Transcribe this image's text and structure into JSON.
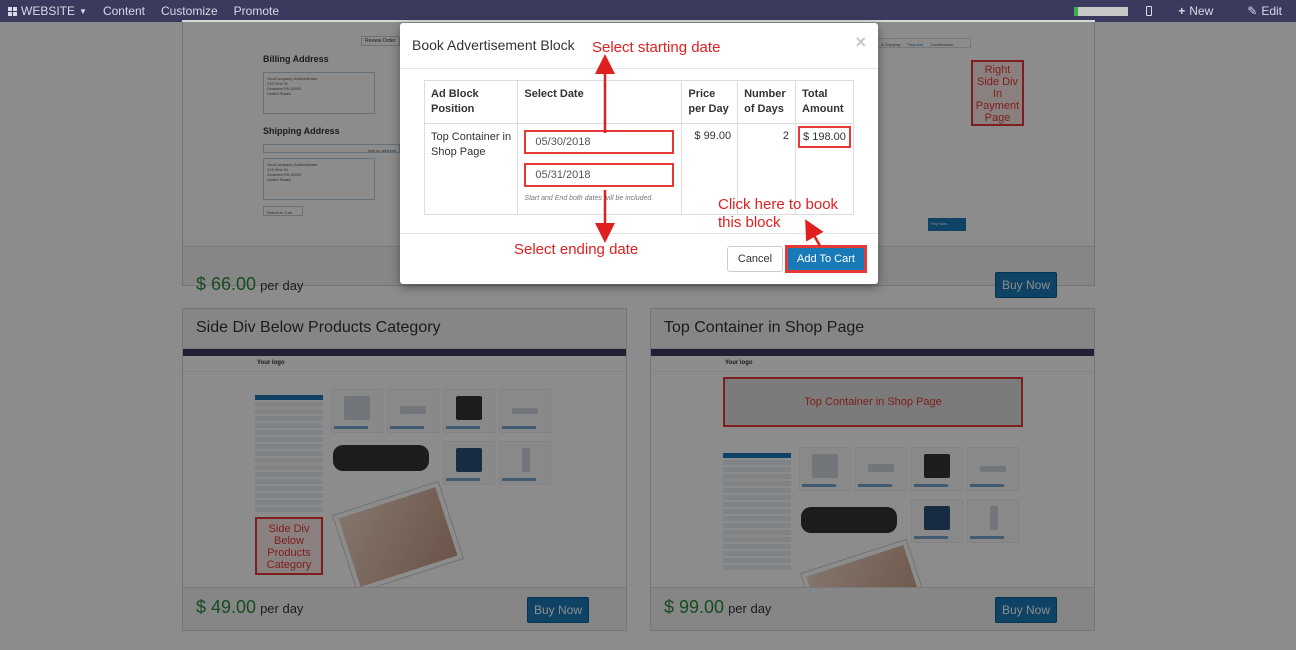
{
  "topbar": {
    "website": "WEBSITE",
    "content": "Content",
    "customize": "Customize",
    "promote": "Promote",
    "new": "New",
    "edit": "Edit"
  },
  "bg": {
    "top_left_price": "$ 66.00",
    "top_right_buy": "Buy Now",
    "per_day": "per day",
    "billing_address": "Billing Address",
    "shipping_address": "Shipping Address",
    "review_order": "Review Order",
    "add_address": "Add an address",
    "return_to_cart": "Return to Cart",
    "pay_now": "Pay Now",
    "tab_shipping": "& Shipping",
    "tab_payment": "Payment",
    "tab_confirmation": "Confirmation",
    "right_side_div_note": "Right Side Div In Payment Page",
    "address_lines": [
      "YourCompany, Administrator",
      "215 Vine St",
      "Scranton PA 18503",
      "United States"
    ]
  },
  "cards": [
    {
      "title": "Side Div Below Products Category",
      "price": "$ 49.00",
      "per_day": "per day",
      "buy": "Buy Now",
      "note": "Side Div Below Products Category"
    },
    {
      "title": "Top Container in Shop Page",
      "price": "$ 99.00",
      "per_day": "per day",
      "buy": "Buy Now",
      "note": "Top Container in Shop Page"
    }
  ],
  "mini": {
    "logo": "Your logo",
    "all_products": "All Products"
  },
  "modal": {
    "title": "Book Advertisement Block",
    "close": "×",
    "headers": {
      "position": "Ad Block Position",
      "date": "Select Date",
      "price": "Price per Day",
      "days": "Number of Days",
      "total": "Total Amount"
    },
    "row": {
      "position": "Top Container in Shop Page",
      "start_date": "05/30/2018",
      "end_date": "05/31/2018",
      "hint": "Start and End both dates will be included.",
      "price": "$ 99.00",
      "days": "2",
      "total": "$ 198.00"
    },
    "cancel": "Cancel",
    "add_to_cart": "Add To Cart"
  },
  "annotations": {
    "start": "Select starting date",
    "end": "Select ending date",
    "book_line1": "Click here to book",
    "book_line2": "this block"
  },
  "colors": {
    "accent": "#1a7ab8",
    "price_green": "#2b8a3e",
    "annotation_red": "#e02020",
    "topbar": "#3b3a5e"
  }
}
